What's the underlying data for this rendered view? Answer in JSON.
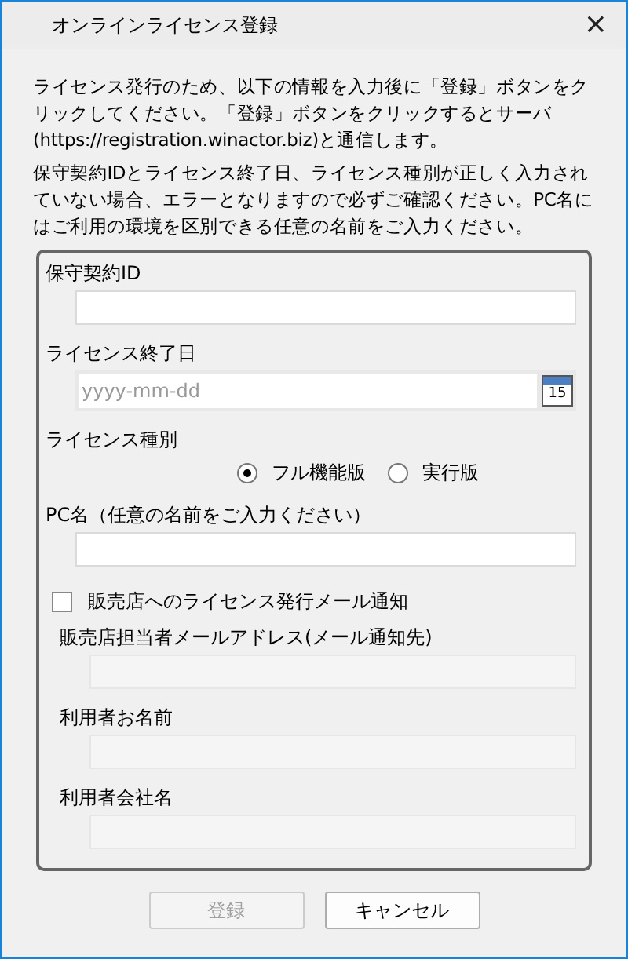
{
  "window": {
    "title": "オンラインライセンス登録",
    "close": "×"
  },
  "intro": [
    "ライセンス発行のため、以下の情報を入力後に「登録」ボタンをクリックしてください。「登録」ボタンをクリックするとサーバ(https://registration.winactor.biz)と通信します。",
    "保守契約IDとライセンス終了日、ライセンス種別が正しく入力されていない場合、エラーとなりますので必ずご確認ください。PC名にはご利用の環境を区別できる任意の名前をご入力ください。"
  ],
  "fields": [
    {
      "kind": "text",
      "label": "保守契約ID",
      "disabled": false
    },
    {
      "kind": "date",
      "label": "ライセンス終了日",
      "placeholder": "yyyy-mm-dd",
      "calendar_day": "15"
    },
    {
      "kind": "radio",
      "label": "ライセンス種別",
      "options": [
        {
          "label": "フル機能版",
          "selected": true
        },
        {
          "label": "実行版",
          "selected": false
        }
      ]
    },
    {
      "kind": "text",
      "label": "PC名（任意の名前をご入力ください）",
      "disabled": false
    },
    {
      "kind": "checkbox",
      "label": "販売店へのライセンス発行メール通知",
      "checked": false
    },
    {
      "kind": "text",
      "label": "販売店担当者メールアドレス(メール通知先)",
      "disabled": true
    },
    {
      "kind": "text",
      "label": "利用者お名前",
      "disabled": true
    },
    {
      "kind": "text",
      "label": "利用者会社名",
      "disabled": true
    }
  ],
  "buttons": [
    {
      "label": "登録",
      "disabled": true
    },
    {
      "label": "キャンセル",
      "disabled": false
    }
  ]
}
